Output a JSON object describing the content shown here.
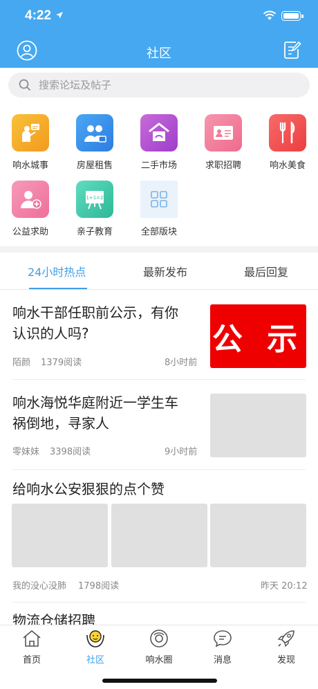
{
  "status_bar": {
    "time": "4:22"
  },
  "header": {
    "title": "社区"
  },
  "search": {
    "placeholder": "搜索论坛及帖子"
  },
  "categories": [
    {
      "label": "响水城事",
      "icon": "town-news-icon",
      "color": "#f5a623"
    },
    {
      "label": "房屋租售",
      "icon": "house-rent-icon",
      "color": "#3a8ee6"
    },
    {
      "label": "二手市场",
      "icon": "second-hand-icon",
      "color": "#b04fd6"
    },
    {
      "label": "求职招聘",
      "icon": "job-card-icon",
      "color": "#f37a9a"
    },
    {
      "label": "响水美食",
      "icon": "food-icon",
      "color": "#f24e4e"
    },
    {
      "label": "公益求助",
      "icon": "charity-help-icon",
      "color": "#f27aa8"
    },
    {
      "label": "亲子教育",
      "icon": "education-board-icon",
      "color": "#3cc9a8"
    },
    {
      "label": "全部版块",
      "icon": "all-sections-icon",
      "color": "#eaf2fb"
    }
  ],
  "tabs": [
    {
      "label": "24小时热点",
      "active": true
    },
    {
      "label": "最新发布",
      "active": false
    },
    {
      "label": "最后回复",
      "active": false
    }
  ],
  "posts": [
    {
      "title_line1": "响水干部任职前公示，有你",
      "title_line2": "认识的人吗?",
      "author": "陌颜",
      "reads": "1379阅读",
      "time": "8小时前",
      "thumb_text": "公 示"
    },
    {
      "title_line1": "响水海悦华庭附近一学生车",
      "title_line2": "祸倒地，寻家人",
      "author": "零妹妹",
      "reads": "3398阅读",
      "time": "9小时前"
    },
    {
      "title_line1": "给响水公安狠狠的点个赞",
      "author": "我的没心没肺",
      "reads": "1798阅读",
      "time": "昨天 20:12"
    },
    {
      "title_line1": "物流仓储招聘"
    }
  ],
  "tabbar": [
    {
      "label": "首页",
      "icon": "home-icon",
      "active": false
    },
    {
      "label": "社区",
      "icon": "community-icon",
      "active": true
    },
    {
      "label": "响水圈",
      "icon": "circle-icon",
      "active": false
    },
    {
      "label": "消息",
      "icon": "message-icon",
      "active": false
    },
    {
      "label": "发现",
      "icon": "discover-rocket-icon",
      "active": false
    }
  ],
  "colors": {
    "primary": "#45a8f1",
    "active_text": "#3d9fe8"
  }
}
